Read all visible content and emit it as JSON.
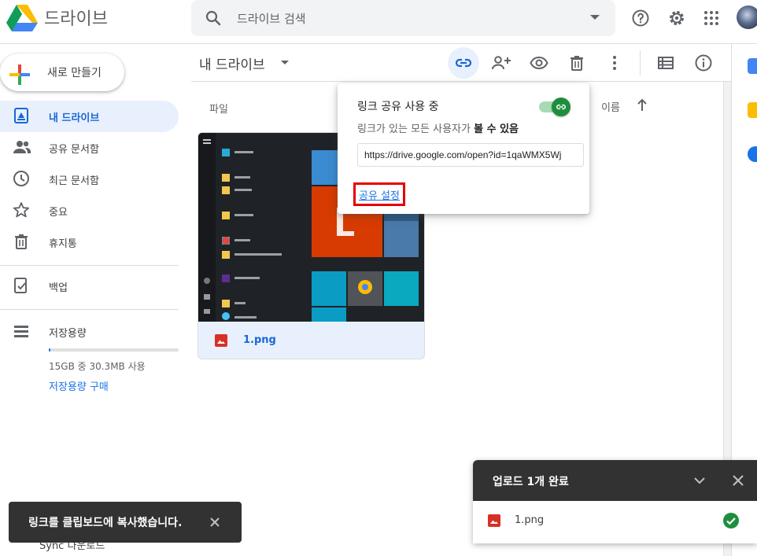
{
  "app": {
    "name": "드라이브"
  },
  "search": {
    "placeholder": "드라이브 검색"
  },
  "sidebar": {
    "new_label": "새로 만들기",
    "items": [
      {
        "label": "내 드라이브",
        "icon": "drive-icon",
        "active": true
      },
      {
        "label": "공유 문서함",
        "icon": "people-icon"
      },
      {
        "label": "최근 문서함",
        "icon": "clock-icon"
      },
      {
        "label": "중요",
        "icon": "star-icon"
      },
      {
        "label": "휴지통",
        "icon": "trash-icon"
      },
      {
        "label": "백업",
        "icon": "backup-icon"
      },
      {
        "label": "저장용량",
        "icon": "storage-icon"
      }
    ],
    "storage_used": "15GB 중 30.3MB 사용",
    "storage_used_fraction": 0.002,
    "storage_buy": "저장용량 구매"
  },
  "toolbar": {
    "title": "내 드라이브",
    "buttons": [
      "link-icon",
      "add-person-icon",
      "eye-icon",
      "trash-icon",
      "more-vert-icon",
      "list-view-icon",
      "info-icon"
    ]
  },
  "content": {
    "files_heading": "파일",
    "sort_label": "이름",
    "file": {
      "name": "1.png"
    }
  },
  "share_popup": {
    "title": "링크 공유 사용 중",
    "toggle_on": true,
    "desc_prefix": "링크가 있는 모든 사용자가",
    "desc_bold": "볼 수 있음",
    "link_value": "https://drive.google.com/open?id=1qaWMX5Wj",
    "settings_link": "공유 설정"
  },
  "snackbar": {
    "message": "링크를 클립보드에 복사했습니다."
  },
  "sync_peek": "Sync 다운로드",
  "upload_panel": {
    "title": "업로드 1개 완료",
    "file_name": "1.png",
    "status": "complete"
  },
  "colors": {
    "accent": "#1a73e8",
    "active_bg": "#e8f0fe",
    "success": "#1e8e3e",
    "highlight_border": "#e50000",
    "snackbar_bg": "#323232"
  }
}
